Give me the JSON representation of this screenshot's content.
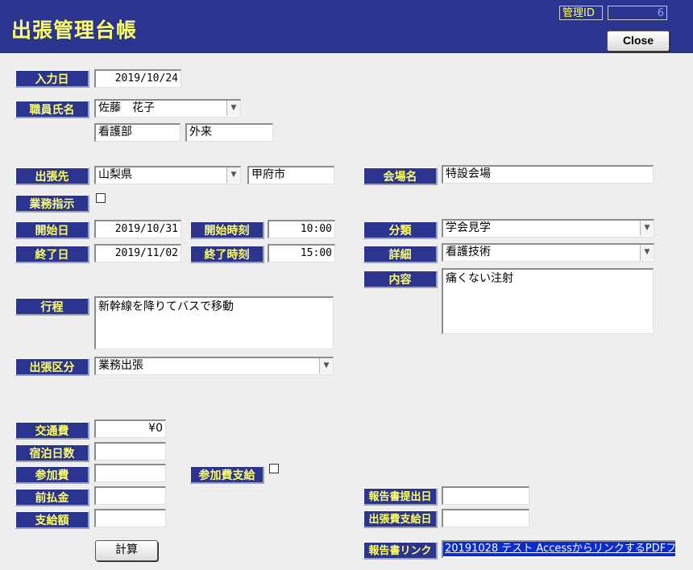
{
  "header": {
    "title": "出張管理台帳",
    "id_label": "管理ID",
    "id_value": "6",
    "close_label": "Close"
  },
  "form": {
    "input_date": {
      "label": "入力日",
      "value": "2019/10/24"
    },
    "staff_name": {
      "label": "職員氏名",
      "value": "佐藤　花子",
      "dept": "看護部",
      "section": "外来"
    },
    "destination": {
      "label": "出張先",
      "prefecture": "山梨県",
      "city": "甲府市"
    },
    "venue": {
      "label": "会場名",
      "value": "特設会場"
    },
    "work_order": {
      "label": "業務指示",
      "checked": false
    },
    "start_date": {
      "label": "開始日",
      "value": "2019/10/31"
    },
    "start_time": {
      "label": "開始時刻",
      "value": "10:00"
    },
    "end_date": {
      "label": "終了日",
      "value": "2019/11/02"
    },
    "end_time": {
      "label": "終了時刻",
      "value": "15:00"
    },
    "category": {
      "label": "分類",
      "value": "学会見学"
    },
    "detail": {
      "label": "詳細",
      "value": "看護技術"
    },
    "content": {
      "label": "内容",
      "value": "痛くない注射"
    },
    "itinerary": {
      "label": "行程",
      "value": "新幹線を降りてバスで移動"
    },
    "trip_type": {
      "label": "出張区分",
      "value": "業務出張"
    },
    "transport_cost": {
      "label": "交通費",
      "value": "¥0"
    },
    "nights": {
      "label": "宿泊日数",
      "value": ""
    },
    "fee": {
      "label": "参加費",
      "value": ""
    },
    "fee_paid": {
      "label": "参加費支給",
      "checked": false
    },
    "advance": {
      "label": "前払金",
      "value": ""
    },
    "payment": {
      "label": "支給額",
      "value": ""
    },
    "report_date": {
      "label": "報告書提出日",
      "value": ""
    },
    "expense_date": {
      "label": "出張費支給日",
      "value": ""
    },
    "report_link": {
      "label": "報告書リンク",
      "value": "20191028 テスト AccessからリンクするPDFフ"
    },
    "calc_button": "計算"
  },
  "colors": {
    "header_bg": "#2b3590",
    "label_bg": "#2b3590",
    "label_text": "#ffff66",
    "page_bg": "#eeeeee",
    "link_bg": "#0a2bd0"
  }
}
